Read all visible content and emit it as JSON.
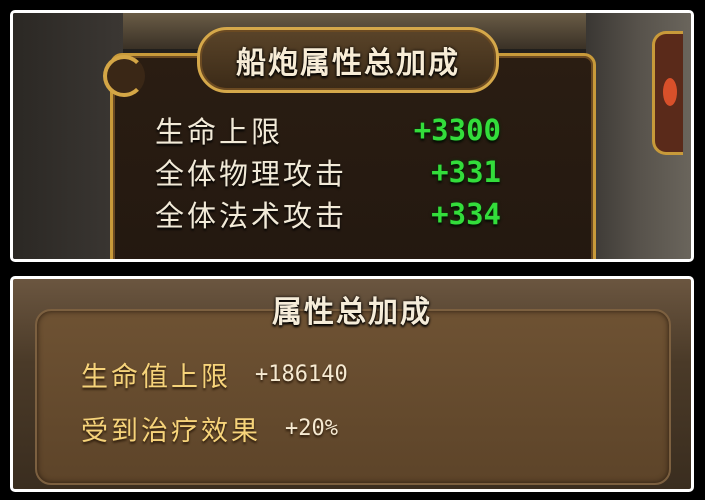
{
  "cannon_panel": {
    "title": "船炮属性总加成",
    "stats": [
      {
        "label": "生命上限",
        "value": "+3300"
      },
      {
        "label": "全体物理攻击",
        "value": "+331"
      },
      {
        "label": "全体法术攻击",
        "value": "+334"
      }
    ]
  },
  "attribute_panel": {
    "title": "属性总加成",
    "stats": [
      {
        "label": "生命值上限",
        "value": "+186140"
      },
      {
        "label": "受到治疗效果",
        "value": "+20%"
      }
    ]
  },
  "colors": {
    "cannon_value": "#33dd3b",
    "cannon_label": "#f2ead8",
    "attr_label": "#f6d37a",
    "attr_value": "#f6ead2",
    "gold_frame": "#c89a3a"
  }
}
